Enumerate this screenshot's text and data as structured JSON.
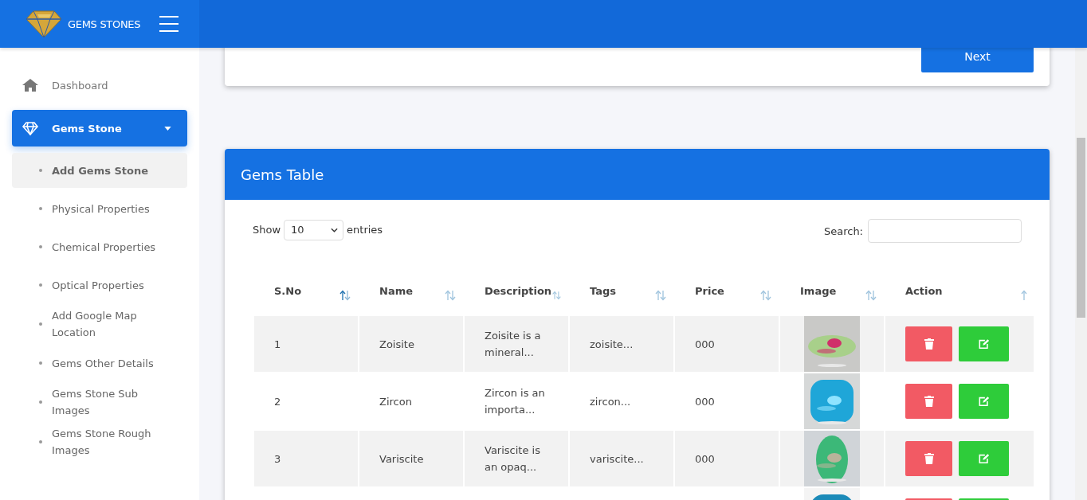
{
  "brand": {
    "name": "GEMS STONES"
  },
  "sidebar": {
    "items": [
      {
        "label": "Dashboard",
        "kind": "link",
        "selected": false
      },
      {
        "label": "Gems Stone",
        "kind": "menu",
        "selected": true,
        "expanded": true,
        "children": [
          {
            "label": "Add Gems Stone",
            "selected": true
          },
          {
            "label": "Physical Properties",
            "selected": false
          },
          {
            "label": "Chemical Properties",
            "selected": false
          },
          {
            "label": "Optical Properties",
            "selected": false
          },
          {
            "label": "Add Google Map Location",
            "selected": false
          },
          {
            "label": "Gems Other Details",
            "selected": false
          },
          {
            "label": "Gems Stone Sub Images",
            "selected": false
          },
          {
            "label": "Gems Stone Rough Images",
            "selected": false
          }
        ]
      }
    ]
  },
  "form_card": {
    "next_button": "Next"
  },
  "table_card": {
    "title": "Gems Table",
    "show_label": "Show",
    "page_size": "10",
    "entries_label": "entries",
    "search_label": "Search:",
    "columns": [
      {
        "label": "S.No",
        "kind": "data",
        "sorted": true
      },
      {
        "label": "Name",
        "kind": "data",
        "sorted": false
      },
      {
        "label": "Description",
        "kind": "data",
        "sorted": false
      },
      {
        "label": "Tags",
        "kind": "data",
        "sorted": false
      },
      {
        "label": "Price",
        "kind": "data",
        "sorted": false
      },
      {
        "label": "Image",
        "kind": "data",
        "sorted": false
      },
      {
        "label": "Action",
        "kind": "action",
        "sorted": false
      }
    ],
    "rows": [
      {
        "sno": "1",
        "name": "Zoisite",
        "description": "Zoisite is a mineral...",
        "tags": "zoisite...",
        "price": "000"
      },
      {
        "sno": "2",
        "name": "Zircon",
        "description": "Zircon is an importa...",
        "tags": "zircon...",
        "price": "000"
      },
      {
        "sno": "3",
        "name": "Variscite",
        "description": "Variscite is an opaq...",
        "tags": "variscite...",
        "price": "000"
      },
      {}
    ]
  }
}
